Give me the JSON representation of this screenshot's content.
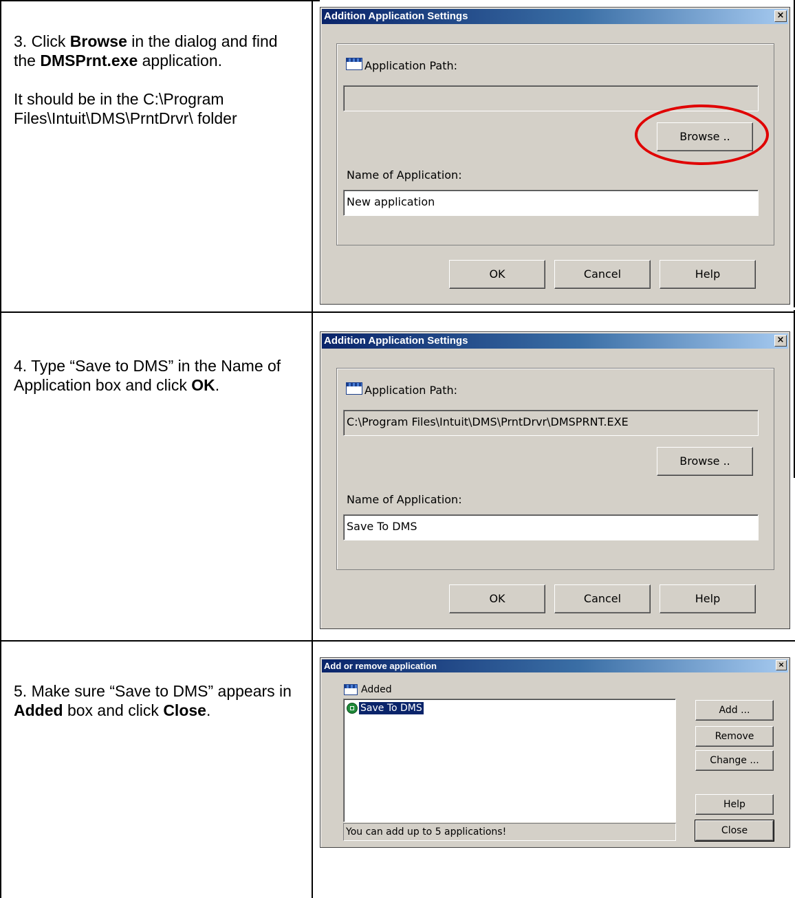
{
  "steps": [
    {
      "p1": {
        "a": "3. Click ",
        "b": "Browse",
        "c": " in the dialog and find the ",
        "d": "DMSPrnt.exe",
        "e": " application."
      },
      "p2": "It should be in the C:\\Program Files\\Intuit\\DMS\\PrntDrvr\\ folder"
    },
    {
      "p1": {
        "a": "4. Type “Save to DMS” in the Name of Application box and click ",
        "b": "OK",
        "c": "."
      }
    },
    {
      "p1": {
        "a": "5. Make sure “Save to DMS” appears in ",
        "b": "Added",
        "c": " box and click ",
        "d": "Close",
        "e": "."
      }
    }
  ],
  "dialog1": {
    "title": "Addition Application Settings",
    "close_glyph": "×",
    "path_label": "Application Path:",
    "path_value": "",
    "browse": "Browse ..",
    "name_label": "Name of Application:",
    "name_value": "New application",
    "ok": "OK",
    "cancel": "Cancel",
    "help": "Help",
    "highlight_color": "#e00000"
  },
  "dialog2": {
    "title": "Addition Application Settings",
    "close_glyph": "×",
    "path_label": "Application Path:",
    "path_value": "C:\\Program Files\\Intuit\\DMS\\PrntDrvr\\DMSPRNT.EXE",
    "browse": "Browse ..",
    "name_label": "Name of Application:",
    "name_value": "Save To DMS",
    "ok": "OK",
    "cancel": "Cancel",
    "help": "Help"
  },
  "dialog3": {
    "title": "Add or remove application",
    "close_glyph": "×",
    "added_label": "Added",
    "items": [
      "Save To DMS"
    ],
    "add": "Add ...",
    "remove": "Remove",
    "change": "Change ...",
    "help": "Help",
    "close": "Close",
    "status": "You can add up to 5 applications!"
  },
  "colors": {
    "dialog_bg": "#d4d0c8",
    "title_bar": "#0a246a",
    "selection": "#0a246a"
  }
}
